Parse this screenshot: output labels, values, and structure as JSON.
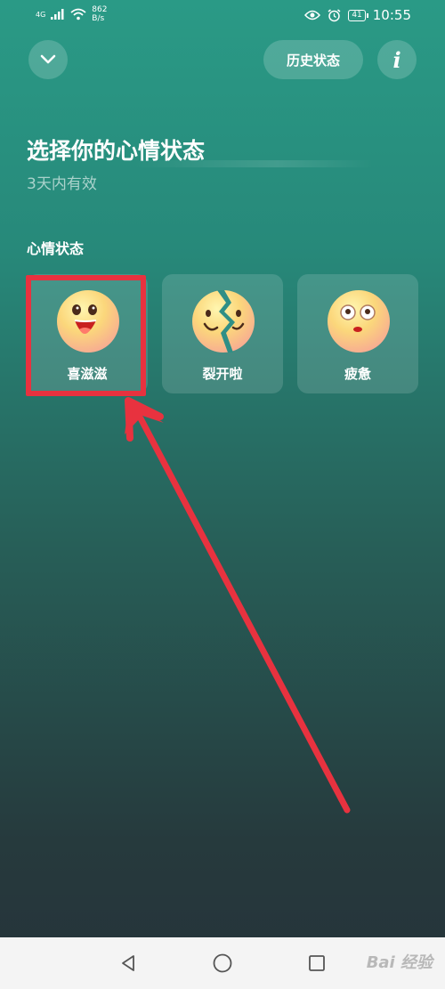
{
  "status_bar": {
    "network": "4G",
    "speed_value": "862",
    "speed_unit": "B/s",
    "battery": "41",
    "time": "10:55"
  },
  "header": {
    "history_label": "历史状态",
    "info_label": "i"
  },
  "main": {
    "title": "选择你的心情状态",
    "subtitle": "3天内有效",
    "section_label": "心情状态",
    "moods": [
      {
        "label": "喜滋滋",
        "icon": "happy-face-icon"
      },
      {
        "label": "裂开啦",
        "icon": "cracked-face-icon"
      },
      {
        "label": "疲惫",
        "icon": "tired-face-icon"
      }
    ]
  },
  "annotation": {
    "highlight_color": "#e8323f"
  },
  "nav_bar": {
    "watermark": "Bai 经验"
  },
  "colors": {
    "accent": "#2a9a86",
    "card_bg": "rgba(255,255,255,0.14)",
    "emoji_yellow": "#fbd77b"
  }
}
